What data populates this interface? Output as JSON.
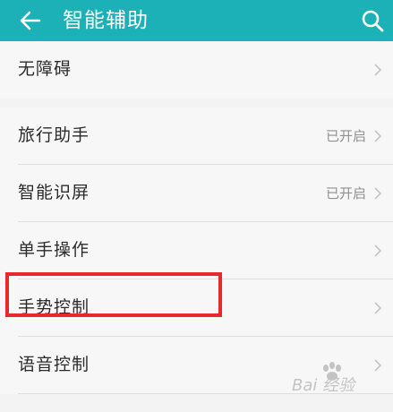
{
  "header": {
    "title": "智能辅助",
    "background_color": "#1cb1b6"
  },
  "items": [
    {
      "label": "无障碍",
      "value": ""
    },
    {
      "label": "旅行助手",
      "value": "已开启"
    },
    {
      "label": "智能识屏",
      "value": "已开启"
    },
    {
      "label": "单手操作",
      "value": ""
    },
    {
      "label": "手势控制",
      "value": ""
    },
    {
      "label": "语音控制",
      "value": ""
    }
  ],
  "highlight_color": "#e8282b",
  "watermark": {
    "text": "Bai 经验"
  }
}
